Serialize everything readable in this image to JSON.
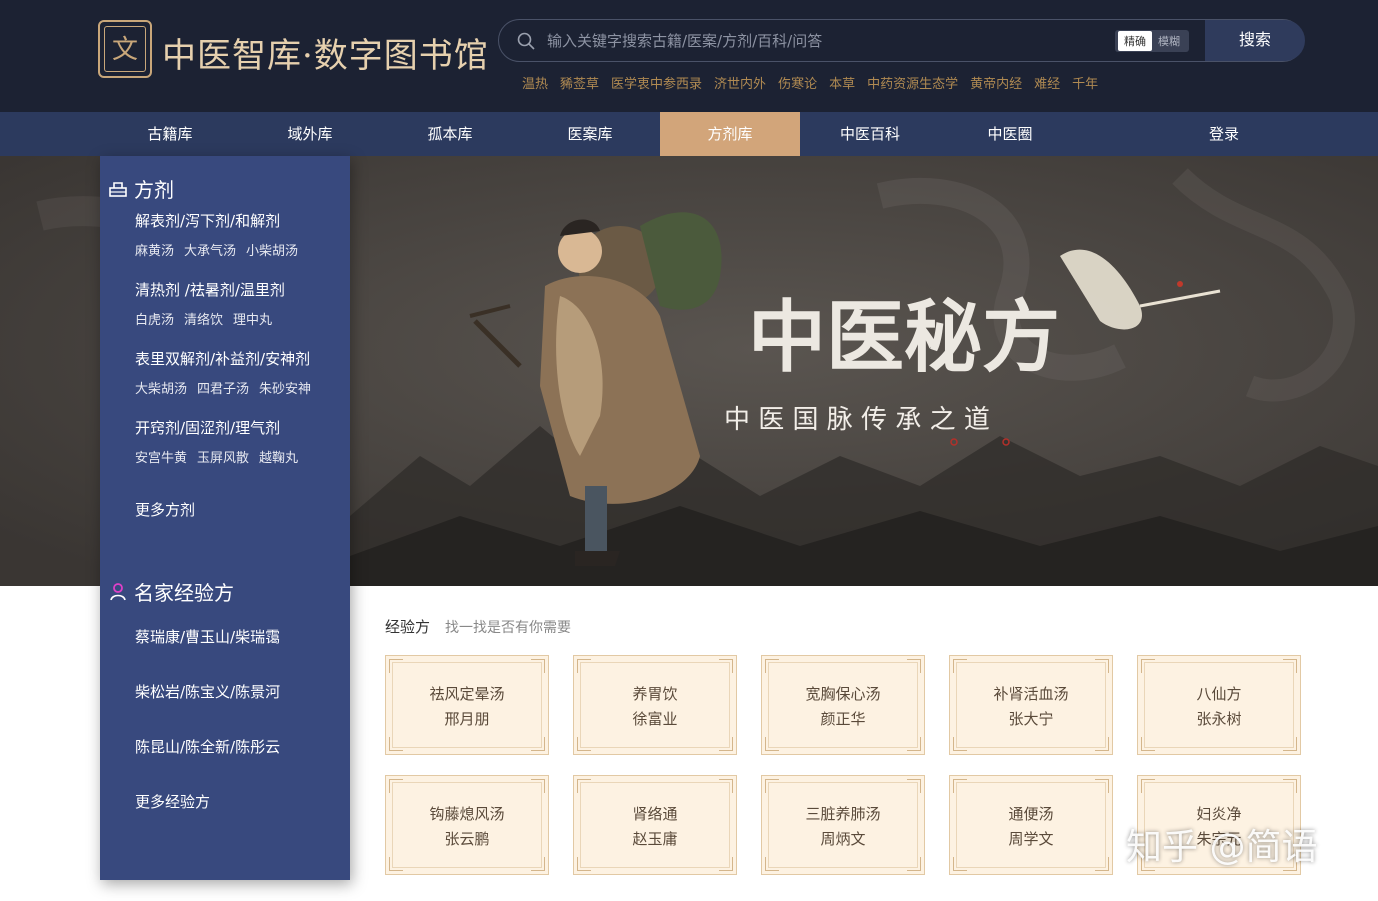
{
  "header": {
    "logo_text": "中医智库·数字图书馆",
    "logo_glyph": "文",
    "search": {
      "placeholder": "输入关键字搜索古籍/医案/方剂/百科/问答",
      "mode_exact": "精确",
      "mode_fuzzy": "模糊",
      "button": "搜索"
    },
    "hot_keywords": [
      "温热",
      "豨莶草",
      "医学衷中参西录",
      "济世内外",
      "伤寒论",
      "本草",
      "中药资源生态学",
      "黄帝内经",
      "难经",
      "千年"
    ]
  },
  "nav": {
    "items": [
      "古籍库",
      "域外库",
      "孤本库",
      "医案库",
      "方剂库",
      "中医百科",
      "中医圈"
    ],
    "active": "方剂库",
    "login": "登录"
  },
  "banner": {
    "title": "中医秘方",
    "subtitle": "中 医 国 脉 传 承 之 道"
  },
  "sidebar": {
    "formula_title": "方剂",
    "categories": [
      {
        "name": "解表剂/泻下剂/和解剂",
        "items": [
          "麻黄汤",
          "大承气汤",
          "小柴胡汤"
        ]
      },
      {
        "name": "清热剂 /祛暑剂/温里剂",
        "items": [
          "白虎汤",
          "清络饮",
          "理中丸"
        ]
      },
      {
        "name": "表里双解剂/补益剂/安神剂",
        "items": [
          "大柴胡汤",
          "四君子汤",
          "朱砂安神"
        ]
      },
      {
        "name": "开窍剂/固涩剂/理气剂",
        "items": [
          "安宫牛黄",
          "玉屏风散",
          "越鞠丸"
        ]
      }
    ],
    "more_formulas": "更多方剂",
    "experts_title": "名家经验方",
    "experts": [
      "蔡瑞康/曹玉山/柴瑞霭",
      "柴松岩/陈宝义/陈景河",
      "陈昆山/陈全新/陈彤云"
    ],
    "more_experts": "更多经验方"
  },
  "content": {
    "section_title": "经验方",
    "section_subtitle": "找一找是否有你需要",
    "cards": [
      {
        "name": "祛风定晕汤",
        "author": "邢月朋"
      },
      {
        "name": "养胃饮",
        "author": "徐富业"
      },
      {
        "name": "宽胸保心汤",
        "author": "颜正华"
      },
      {
        "name": "补肾活血汤",
        "author": "张大宁"
      },
      {
        "name": "八仙方",
        "author": "张永树"
      },
      {
        "name": "钩藤熄风汤",
        "author": "张云鹏"
      },
      {
        "name": "肾络通",
        "author": "赵玉庸"
      },
      {
        "name": "三脏养肺汤",
        "author": "周炳文"
      },
      {
        "name": "通便汤",
        "author": "周学文"
      },
      {
        "name": "妇炎净",
        "author": "朱宗元"
      }
    ]
  },
  "watermark": "知乎 @简语",
  "colors": {
    "header_bg": "#1c2233",
    "nav_bg": "#2c3a5e",
    "nav_active": "#d2a57a",
    "sidebar_bg": "#38497e",
    "accent_gold": "#b08a52",
    "card_bg": "#fdf2e2"
  }
}
